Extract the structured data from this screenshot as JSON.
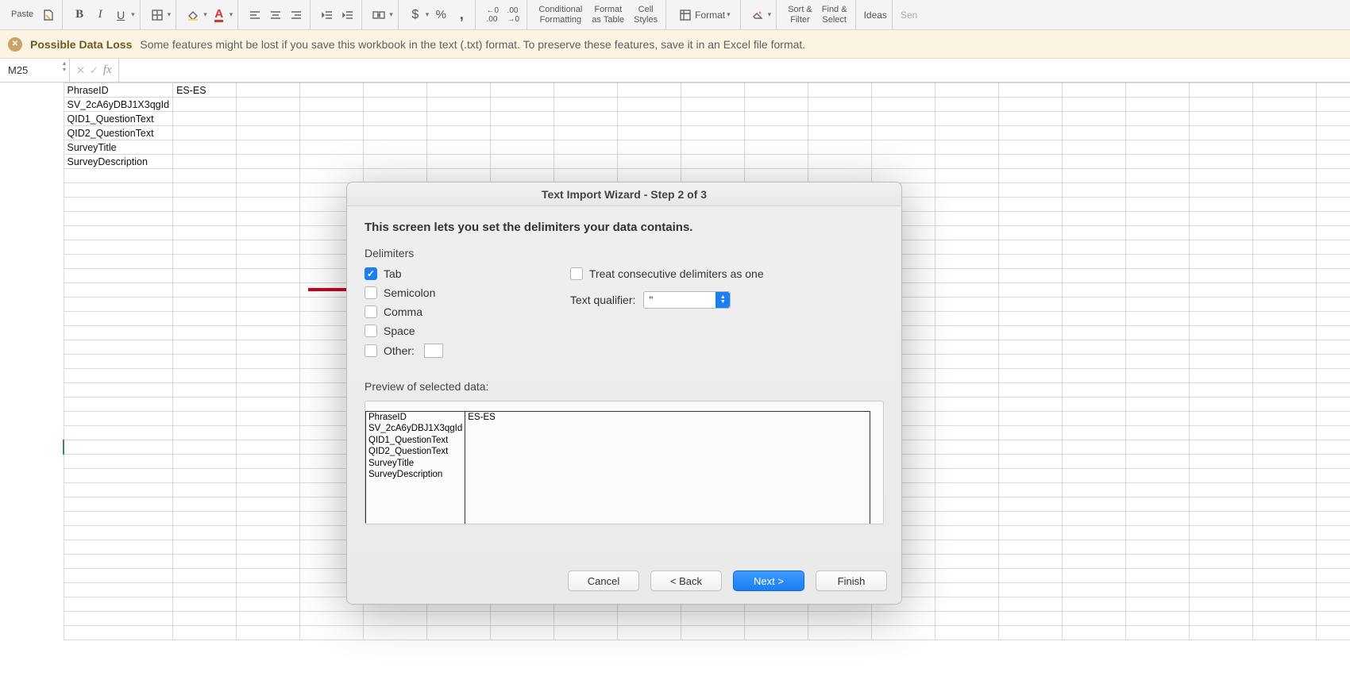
{
  "ribbon": {
    "paste_label": "Paste",
    "conditional_top": "Conditional",
    "conditional_bottom": "Formatting",
    "formatastable_top": "Format",
    "formatastable_bottom": "as Table",
    "cellstyles_top": "Cell",
    "cellstyles_bottom": "Styles",
    "format_label": "Format",
    "sort_top": "Sort &",
    "sort_bottom": "Filter",
    "find_top": "Find &",
    "find_bottom": "Select",
    "ideas_label": "Ideas",
    "sen_label": "Sen"
  },
  "warning": {
    "title": "Possible Data Loss",
    "message": "Some features might be lost if you save this workbook in the text (.txt) format. To preserve these features, save it in an Excel file format."
  },
  "namebox": {
    "ref": "M25"
  },
  "sheet": {
    "rows": [
      [
        "PhraseID",
        "ES-ES"
      ],
      [
        "SV_2cA6yDBJ1X3qgId",
        ""
      ],
      [
        "QID1_QuestionText",
        ""
      ],
      [
        "QID2_QuestionText",
        ""
      ],
      [
        "SurveyTitle",
        ""
      ],
      [
        "SurveyDescription",
        ""
      ]
    ]
  },
  "dialog": {
    "title": "Text Import Wizard - Step 2 of 3",
    "heading": "This screen lets you set the delimiters your data contains.",
    "delimiters_label": "Delimiters",
    "tab_label": "Tab",
    "semicolon_label": "Semicolon",
    "comma_label": "Comma",
    "space_label": "Space",
    "other_label": "Other:",
    "treat_consecutive_label": "Treat consecutive delimiters as one",
    "text_qualifier_label": "Text qualifier:",
    "text_qualifier_value": "\"",
    "preview_label": "Preview of selected data:",
    "preview_col1": "PhraseID",
    "preview_col2": "ES-ES",
    "preview_r1": "SV_2cA6yDBJ1X3qgId",
    "preview_r2": "QID1_QuestionText",
    "preview_r3": "QID2_QuestionText",
    "preview_r4": "SurveyTitle",
    "preview_r5": "SurveyDescription",
    "cancel_label": "Cancel",
    "back_label": "< Back",
    "next_label": "Next >",
    "finish_label": "Finish"
  }
}
